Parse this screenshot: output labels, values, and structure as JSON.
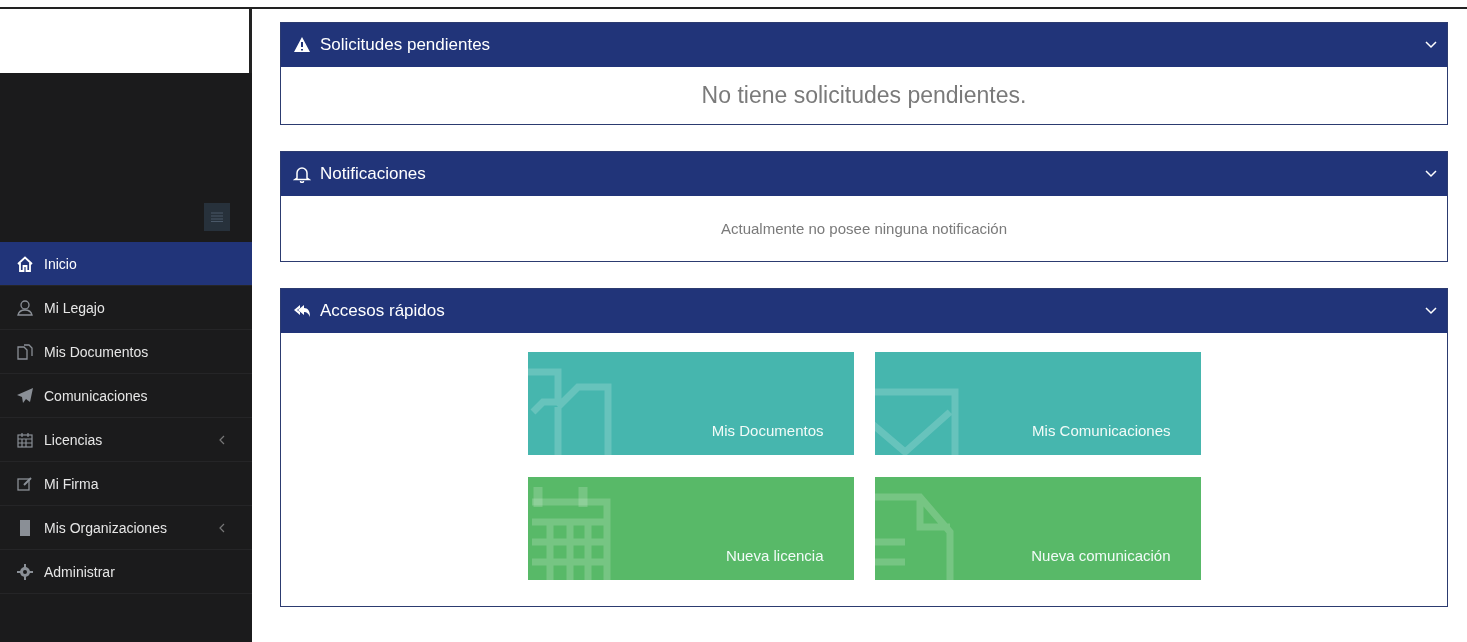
{
  "sidebar": {
    "items": [
      {
        "label": "Inicio",
        "selected": true,
        "submenu": false
      },
      {
        "label": "Mi Legajo",
        "selected": false,
        "submenu": false
      },
      {
        "label": "Mis Documentos",
        "selected": false,
        "submenu": false
      },
      {
        "label": "Comunicaciones",
        "selected": false,
        "submenu": false
      },
      {
        "label": "Licencias",
        "selected": false,
        "submenu": true
      },
      {
        "label": "Mi Firma",
        "selected": false,
        "submenu": false
      },
      {
        "label": "Mis Organizaciones",
        "selected": false,
        "submenu": true
      },
      {
        "label": "Administrar",
        "selected": false,
        "submenu": false
      }
    ]
  },
  "panels": [
    {
      "title": "Solicitudes pendientes",
      "message": "No tiene solicitudes pendientes.",
      "kind": "large"
    },
    {
      "title": "Notificaciones",
      "message": "Actualmente no posee ninguna notificación",
      "kind": "small"
    },
    {
      "title": "Accesos rápidos",
      "kind": "tiles",
      "tiles": [
        {
          "label": "Mis Documentos",
          "color": "#46b6ae",
          "kind": "documents"
        },
        {
          "label": "Mis Comunicaciones",
          "color": "#46b6ae",
          "kind": "envelope"
        },
        {
          "label": "Nueva licencia",
          "color": "#58b968",
          "kind": "calendar"
        },
        {
          "label": "Nueva comunicación",
          "color": "#58b968",
          "kind": "file"
        }
      ]
    }
  ]
}
